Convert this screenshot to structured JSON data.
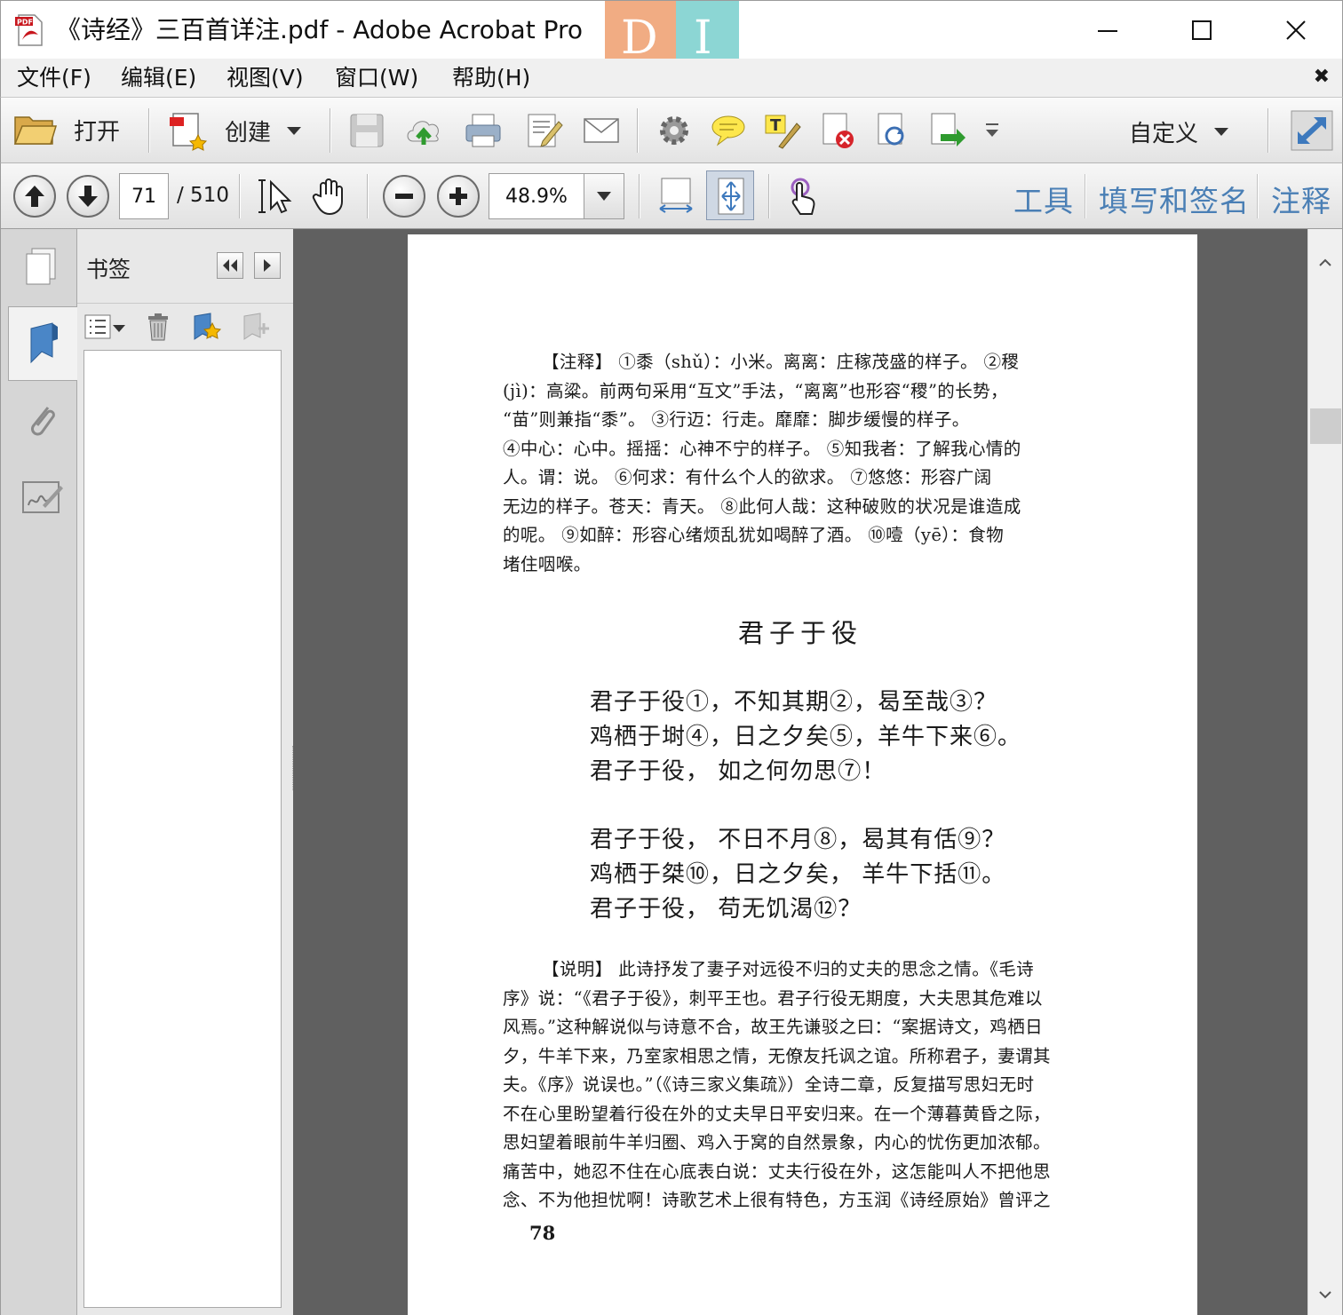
{
  "window": {
    "title": "《诗经》三百首详注.pdf - Adobe Acrobat Pro",
    "logo_left": "D",
    "logo_right": "I"
  },
  "menu": [
    "文件(F)",
    "编辑(E)",
    "视图(V)",
    "窗口(W)",
    "帮助(H)"
  ],
  "toolbar": {
    "open_label": "打开",
    "create_label": "创建",
    "customize_label": "自定义"
  },
  "nav": {
    "current_page": "71",
    "total_pages": "/ 510",
    "zoom": "48.9%"
  },
  "panes": {
    "tools": "工具",
    "fill_sign": "填写和签名",
    "comment": "注释"
  },
  "bookmarks_panel": {
    "title": "书签"
  },
  "document": {
    "notes": [
      "【注释】 ①黍（shǔ）：小米。离离：庄稼茂盛的样子。 ②稷",
      "(jì)：高粱。前两句采用“互文”手法，“离离”也形容“稷”的长势，",
      "“苗”则兼指“黍”。 ③行迈：行走。靡靡：脚步缓慢的样子。",
      "④中心：心中。摇摇：心神不宁的样子。 ⑤知我者：了解我心情的",
      "人。谓：说。 ⑥何求：有什么个人的欲求。 ⑦悠悠：形容广阔",
      "无边的样子。苍天：青天。 ⑧此何人哉：这种破败的状况是谁造成",
      "的呢。 ⑨如醉：形容心绪烦乱犹如喝醉了酒。 ⑩噎（yē）：食物",
      "堵住咽喉。"
    ],
    "poem_title": "君子于役",
    "poem_lines": [
      "君子于役①，不知其期②，曷至哉③？",
      "鸡栖于埘④，日之夕矣⑤，羊牛下来⑥。",
      "君子于役， 如之何勿思⑦！",
      "君子于役， 不日不月⑧，曷其有佸⑨？",
      "鸡栖于桀⑩，日之夕矣， 羊牛下括⑪。",
      "君子于役， 苟无饥渴⑫？"
    ],
    "explain": [
      "【说明】 此诗抒发了妻子对远役不归的丈夫的思念之情。《毛诗",
      "序》说：“《君子于役》，刺平王也。君子行役无期度，大夫思其危难以",
      "风焉。”这种解说似与诗意不合，故王先谦驳之曰：“案据诗文，鸡栖日",
      "夕，牛羊下来，乃室家相思之情，无僚友托讽之谊。所称君子，妻谓其",
      "夫。《序》说误也。”（《诗三家义集疏》）全诗二章，反复描写思妇无时",
      "不在心里盼望着行役在外的丈夫早日平安归来。在一个薄暮黄昏之际，",
      "思妇望着眼前牛羊归圈、鸡入于窝的自然景象，内心的忧伤更加浓郁。",
      "痛苦中，她忍不住在心底表白说：丈夫行役在外，这怎能叫人不把他思",
      "念、不为他担忧啊！诗歌艺术上很有特色，方玉润《诗经原始》曾评之"
    ],
    "page_number": "78"
  }
}
